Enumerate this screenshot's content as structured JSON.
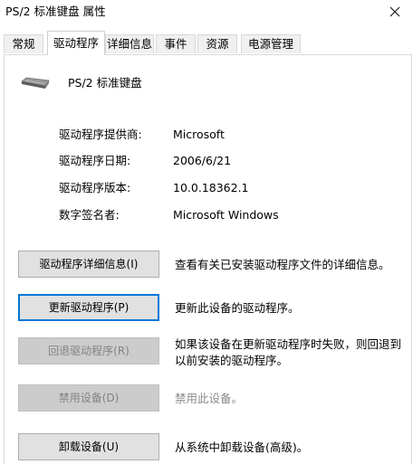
{
  "window": {
    "title": "PS/2 标准键盘 属性"
  },
  "tabs": [
    {
      "label": "常规"
    },
    {
      "label": "驱动程序"
    },
    {
      "label": "详细信息"
    },
    {
      "label": "事件"
    },
    {
      "label": "资源"
    },
    {
      "label": "电源管理"
    }
  ],
  "active_tab": "驱动程序",
  "device": {
    "name": "PS/2 标准键盘",
    "icon": "keyboard-icon"
  },
  "driver_info": {
    "provider_label": "驱动程序提供商:",
    "provider_value": "Microsoft",
    "date_label": "驱动程序日期:",
    "date_value": "2006/6/21",
    "version_label": "驱动程序版本:",
    "version_value": "10.0.18362.1",
    "signer_label": "数字签名者:",
    "signer_value": "Microsoft Windows"
  },
  "actions": {
    "details_label": "驱动程序详细信息(I)",
    "details_desc": "查看有关已安装驱动程序文件的详细信息。",
    "update_label": "更新驱动程序(P)",
    "update_desc": "更新此设备的驱动程序。",
    "rollback_label": "回退驱动程序(R)",
    "rollback_desc": "如果该设备在更新驱动程序时失败，则回退到以前安装的驱动程序。",
    "disable_label": "禁用设备(D)",
    "disable_desc": "禁用此设备。",
    "uninstall_label": "卸载设备(U)",
    "uninstall_desc": "从系统中卸载设备(高级)。"
  },
  "colors": {
    "focus_border": "#0078d7",
    "disabled_text": "#838383"
  }
}
